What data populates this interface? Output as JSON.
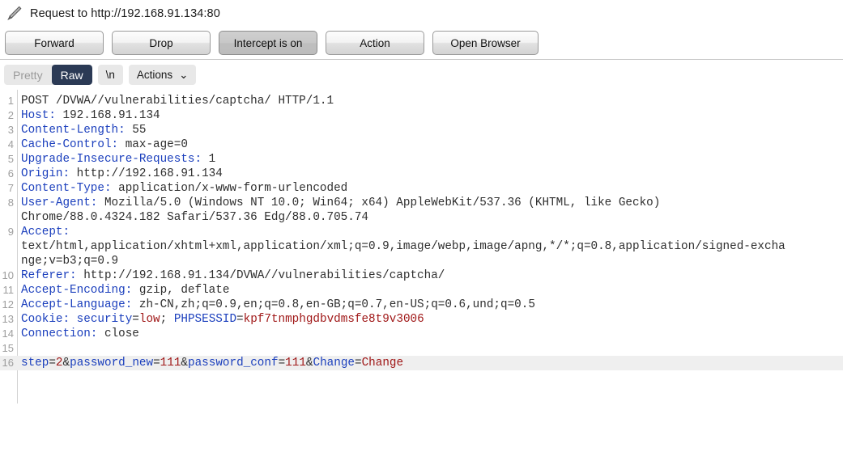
{
  "window": {
    "icon": "pencil-icon",
    "title": "Request to http://192.168.91.134:80"
  },
  "toolbar": {
    "buttons": [
      {
        "label": "Forward",
        "toggled": false
      },
      {
        "label": "Drop",
        "toggled": false
      },
      {
        "label": "Intercept is on",
        "toggled": true
      },
      {
        "label": "Action",
        "toggled": false
      },
      {
        "label": "Open Browser",
        "toggled": false
      }
    ]
  },
  "viewtabs": {
    "pretty_label": "Pretty",
    "raw_label": "Raw",
    "newline_label": "\\n",
    "actions_label": "Actions",
    "actions_caret": "⌄",
    "selected": "Raw"
  },
  "colors": {
    "header_name": "#1b3fbd",
    "header_value": "#2f2f2f",
    "param_value": "#a01818",
    "selected_tab_bg": "#2b3a55",
    "body_highlight": "#efefef"
  },
  "request": {
    "lines": [
      {
        "n": "1",
        "segments": [
          {
            "t": "POST /DVWA//vulnerabilities/captcha/ HTTP/1.1",
            "c": "plain"
          }
        ]
      },
      {
        "n": "2",
        "segments": [
          {
            "t": "Host:",
            "c": "hdr"
          },
          {
            "t": " 192.168.91.134",
            "c": "val"
          }
        ]
      },
      {
        "n": "3",
        "segments": [
          {
            "t": "Content-Length:",
            "c": "hdr"
          },
          {
            "t": " 55",
            "c": "val"
          }
        ]
      },
      {
        "n": "4",
        "segments": [
          {
            "t": "Cache-Control:",
            "c": "hdr"
          },
          {
            "t": " max-age=0",
            "c": "val"
          }
        ]
      },
      {
        "n": "5",
        "segments": [
          {
            "t": "Upgrade-Insecure-Requests:",
            "c": "hdr"
          },
          {
            "t": " 1",
            "c": "val"
          }
        ]
      },
      {
        "n": "6",
        "segments": [
          {
            "t": "Origin:",
            "c": "hdr"
          },
          {
            "t": " http://192.168.91.134",
            "c": "val"
          }
        ]
      },
      {
        "n": "7",
        "segments": [
          {
            "t": "Content-Type:",
            "c": "hdr"
          },
          {
            "t": " application/x-www-form-urlencoded",
            "c": "val"
          }
        ]
      },
      {
        "n": "8",
        "segments": [
          {
            "t": "User-Agent:",
            "c": "hdr"
          },
          {
            "t": " Mozilla/5.0 (Windows NT 10.0; Win64; x64) AppleWebKit/537.36 (KHTML, like Gecko)",
            "c": "val"
          }
        ]
      },
      {
        "n": "",
        "segments": [
          {
            "t": "Chrome/88.0.4324.182 Safari/537.36 Edg/88.0.705.74",
            "c": "val"
          }
        ]
      },
      {
        "n": "9",
        "segments": [
          {
            "t": "Accept:",
            "c": "hdr"
          }
        ]
      },
      {
        "n": "",
        "segments": [
          {
            "t": "text/html,application/xhtml+xml,application/xml;q=0.9,image/webp,image/apng,*/*;q=0.8,application/signed-excha",
            "c": "val"
          }
        ]
      },
      {
        "n": "",
        "segments": [
          {
            "t": "nge;v=b3;q=0.9",
            "c": "val"
          }
        ]
      },
      {
        "n": "10",
        "segments": [
          {
            "t": "Referer:",
            "c": "hdr"
          },
          {
            "t": " http://192.168.91.134/DVWA//vulnerabilities/captcha/",
            "c": "val"
          }
        ]
      },
      {
        "n": "11",
        "segments": [
          {
            "t": "Accept-Encoding:",
            "c": "hdr"
          },
          {
            "t": " gzip, deflate",
            "c": "val"
          }
        ]
      },
      {
        "n": "12",
        "segments": [
          {
            "t": "Accept-Language:",
            "c": "hdr"
          },
          {
            "t": " zh-CN,zh;q=0.9,en;q=0.8,en-GB;q=0.7,en-US;q=0.6,und;q=0.5",
            "c": "val"
          }
        ]
      },
      {
        "n": "13",
        "segments": [
          {
            "t": "Cookie:",
            "c": "hdr"
          },
          {
            "t": " ",
            "c": "val"
          },
          {
            "t": "security",
            "c": "key"
          },
          {
            "t": "=",
            "c": "val"
          },
          {
            "t": "low",
            "c": "red"
          },
          {
            "t": "; ",
            "c": "val"
          },
          {
            "t": "PHPSESSID",
            "c": "key"
          },
          {
            "t": "=",
            "c": "val"
          },
          {
            "t": "kpf7tnmphgdbvdmsfe8t9v3006",
            "c": "red"
          }
        ]
      },
      {
        "n": "14",
        "segments": [
          {
            "t": "Connection:",
            "c": "hdr"
          },
          {
            "t": " close",
            "c": "val"
          }
        ]
      },
      {
        "n": "15",
        "segments": [
          {
            "t": " ",
            "c": "val"
          }
        ]
      },
      {
        "n": "16",
        "highlight": true,
        "segments": [
          {
            "t": "step",
            "c": "key"
          },
          {
            "t": "=",
            "c": "val"
          },
          {
            "t": "2",
            "c": "red"
          },
          {
            "t": "&",
            "c": "val"
          },
          {
            "t": "password_new",
            "c": "key"
          },
          {
            "t": "=",
            "c": "val"
          },
          {
            "t": "111",
            "c": "red"
          },
          {
            "t": "&",
            "c": "val"
          },
          {
            "t": "password_conf",
            "c": "key"
          },
          {
            "t": "=",
            "c": "val"
          },
          {
            "t": "111",
            "c": "red"
          },
          {
            "t": "&",
            "c": "val"
          },
          {
            "t": "Change",
            "c": "key"
          },
          {
            "t": "=",
            "c": "val"
          },
          {
            "t": "Change",
            "c": "red"
          }
        ]
      }
    ]
  }
}
